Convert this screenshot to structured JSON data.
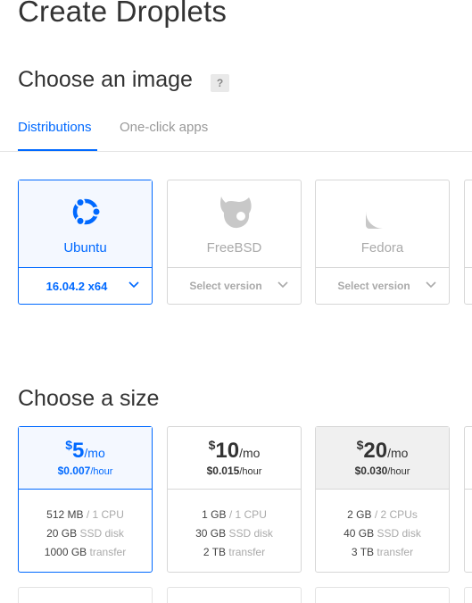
{
  "page": {
    "title": "Create Droplets"
  },
  "image_section": {
    "title": "Choose an image",
    "help": "?",
    "tabs": [
      {
        "label": "Distributions",
        "active": true
      },
      {
        "label": "One-click apps",
        "active": false
      }
    ],
    "distributions": [
      {
        "name": "Ubuntu",
        "version": "16.04.2 x64",
        "selected": true,
        "icon": "ubuntu-icon"
      },
      {
        "name": "FreeBSD",
        "version": "Select version",
        "selected": false,
        "icon": "freebsd-icon"
      },
      {
        "name": "Fedora",
        "version": "Select version",
        "selected": false,
        "icon": "fedora-icon"
      }
    ]
  },
  "size_section": {
    "title": "Choose a size",
    "plans": [
      {
        "currency": "$",
        "amount": "5",
        "per": "/mo",
        "hourly": "$0.007",
        "hour_unit": "/hour",
        "memory": "512 MB",
        "cpu": "/ 1 CPU",
        "disk": "20 GB",
        "disk_unit": "SSD disk",
        "transfer": "1000 GB",
        "transfer_unit": "transfer",
        "selected": true
      },
      {
        "currency": "$",
        "amount": "10",
        "per": "/mo",
        "hourly": "$0.015",
        "hour_unit": "/hour",
        "memory": "1 GB",
        "cpu": "/ 1 CPU",
        "disk": "30 GB",
        "disk_unit": "SSD disk",
        "transfer": "2 TB",
        "transfer_unit": "transfer",
        "selected": false
      },
      {
        "currency": "$",
        "amount": "20",
        "per": "/mo",
        "hourly": "$0.030",
        "hour_unit": "/hour",
        "memory": "2 GB",
        "cpu": "/ 2 CPUs",
        "disk": "40 GB",
        "disk_unit": "SSD disk",
        "transfer": "3 TB",
        "transfer_unit": "transfer",
        "selected": false
      }
    ]
  },
  "colors": {
    "accent": "#0069ff",
    "selected_bg": "#f4f8ff",
    "border": "#d7d7d7",
    "muted": "#aaaaaa"
  }
}
